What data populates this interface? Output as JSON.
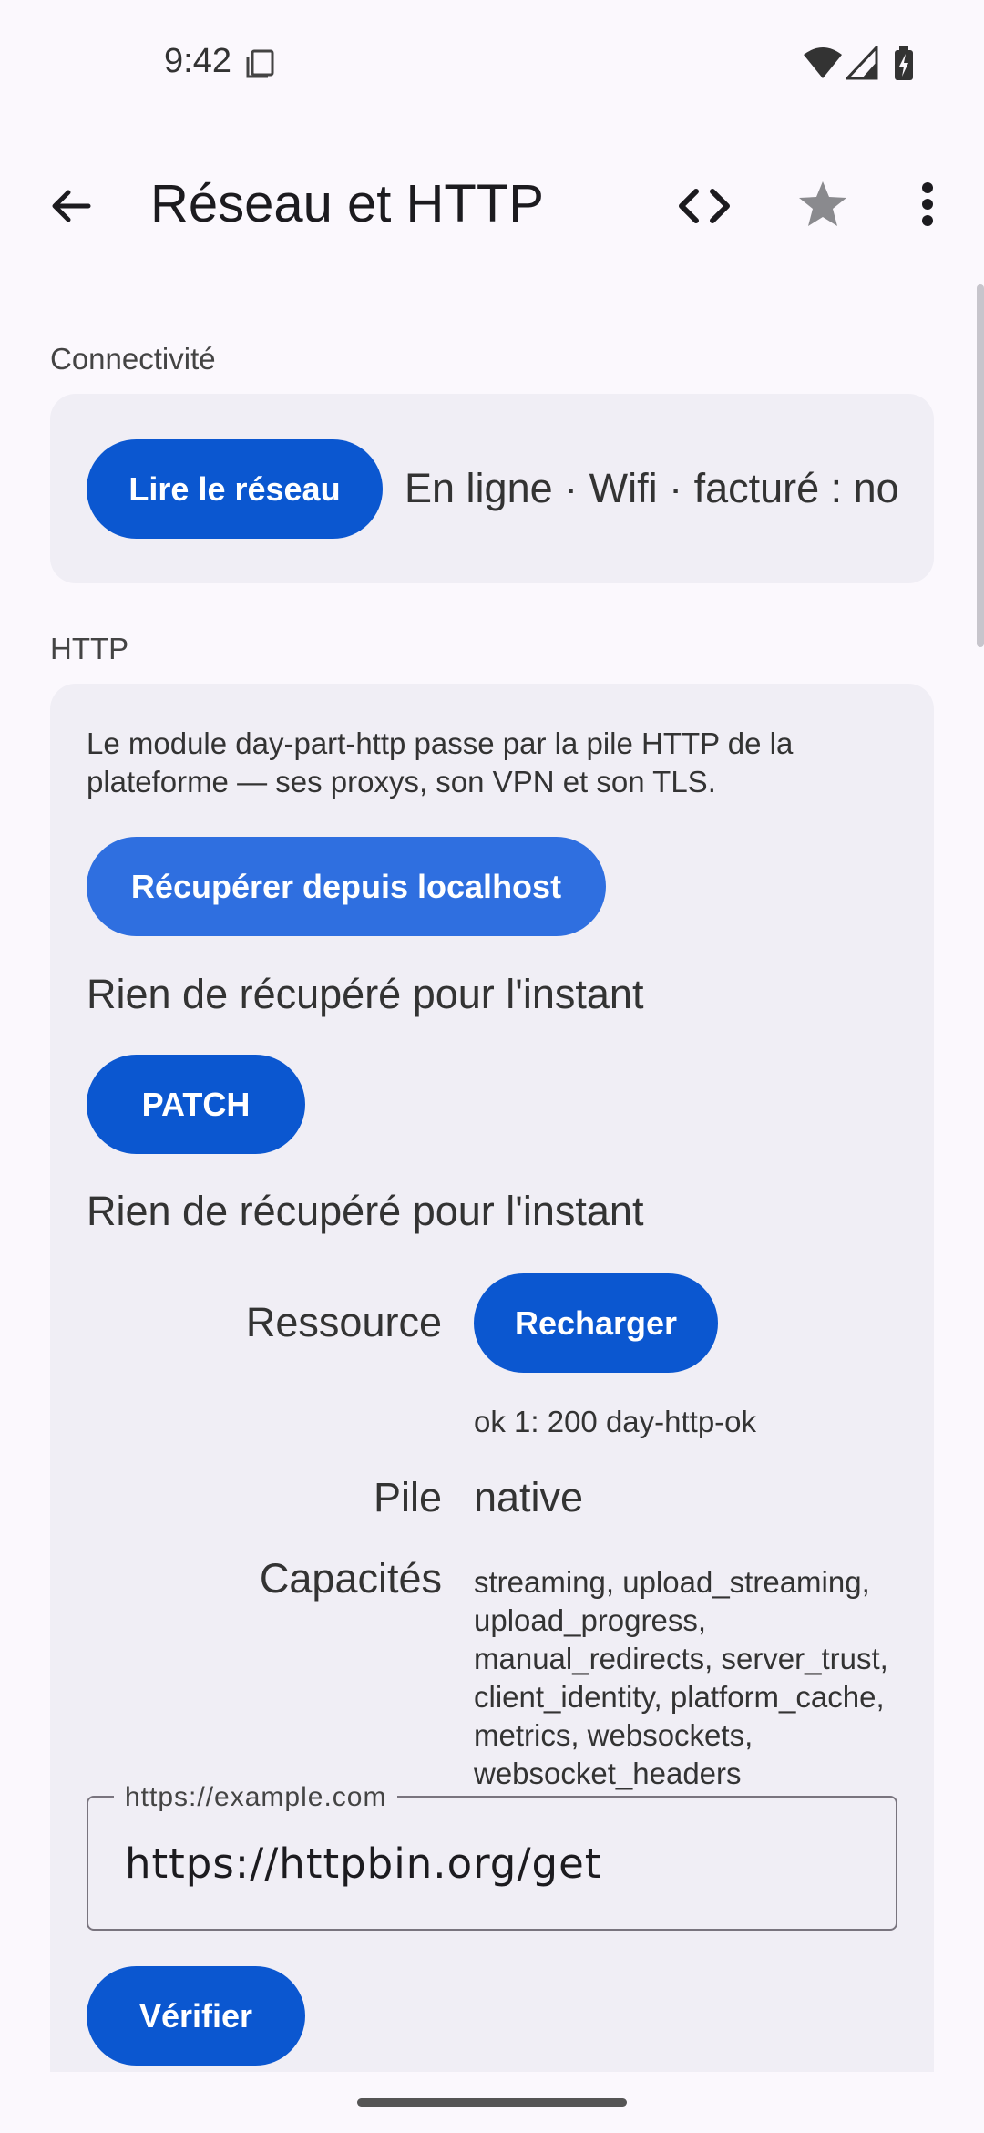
{
  "status_bar": {
    "time": "9:42"
  },
  "app_bar": {
    "title": "Réseau et HTTP",
    "icons": [
      "back-arrow-icon",
      "code-icon",
      "star-icon",
      "more-vert-icon"
    ]
  },
  "connectivity": {
    "heading": "Connectivité",
    "read_button": "Lire le réseau",
    "status_text": "En ligne · Wifi · facturé : no"
  },
  "http": {
    "heading": "HTTP",
    "description": "Le module day-part-http passe par la pile HTTP de la plateforme — ses proxys, son VPN et son TLS.",
    "fetch_button": "Récupérer depuis localhost",
    "fetch_result": "Rien de récupéré pour l'instant",
    "patch_button": "PATCH",
    "patch_result": "Rien de récupéré pour l'instant",
    "resource_label": "Ressource",
    "reload_button": "Recharger",
    "resource_result": "ok 1: 200 day-http-ok",
    "stack_label": "Pile",
    "stack_value": "native",
    "capabilities_label": "Capacités",
    "capabilities_value": "streaming, upload_streaming, upload_progress, manual_redirects, server_trust, client_identity, platform_cache, metrics, websockets, websocket_headers",
    "url_field_label": "https://example.com",
    "url_field_value": "https://httpbin.org/get",
    "verify_button": "Vérifier"
  },
  "colors": {
    "primary": "#0b57d0",
    "card_bg": "#f0eef5",
    "page_bg": "#fbf8fd"
  }
}
